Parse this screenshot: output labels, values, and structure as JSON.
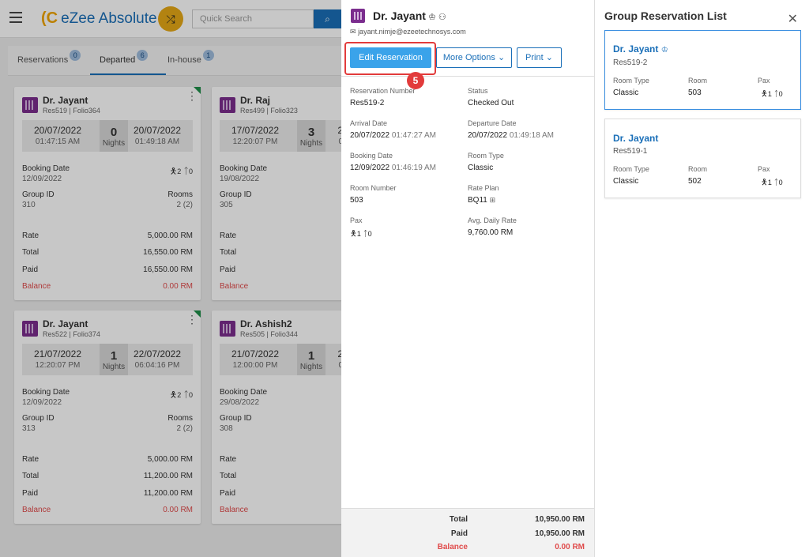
{
  "topbar": {
    "brand": "eZee Absolute",
    "search_placeholder": "Quick Search"
  },
  "tabs": [
    {
      "label": "Reservations",
      "count": "0"
    },
    {
      "label": "Departed",
      "count": "6"
    },
    {
      "label": "In-house",
      "count": "1"
    }
  ],
  "cards": [
    {
      "name": "Dr. Jayant",
      "res": "Res519 | Folio364",
      "arrival_date": "20/07/2022",
      "arrival_time": "01:47:15 AM",
      "nights": "0",
      "nights_label": "Nights",
      "departure_date": "20/07/2022",
      "departure_time": "01:49:18 AM",
      "booking_label": "Booking Date",
      "booking_date": "12/09/2022",
      "adults": "2",
      "children": "0",
      "group_label": "Group ID",
      "group_id": "310",
      "rooms_label": "Rooms",
      "rooms": "2 (2)",
      "rate_label": "Rate",
      "rate": "5,000.00 RM",
      "total_label": "Total",
      "total": "16,550.00 RM",
      "paid_label": "Paid",
      "paid": "16,550.00 RM",
      "balance_label": "Balance",
      "balance": "0.00 RM"
    },
    {
      "name": "Dr. Raj",
      "res": "Res499 | Folio323",
      "arrival_date": "17/07/2022",
      "arrival_time": "12:20:07 PM",
      "nights": "3",
      "nights_label": "Nights",
      "departure_date": "20",
      "departure_time": "04",
      "booking_label": "Booking Date",
      "booking_date": "19/08/2022",
      "group_label": "Group ID",
      "group_id": "305",
      "rate_label": "Rate",
      "total_label": "Total",
      "paid_label": "Paid",
      "balance_label": "Balance"
    },
    {
      "name": "Dr. Jayant",
      "res": "Res522 | Folio374",
      "arrival_date": "21/07/2022",
      "arrival_time": "12:20:07 PM",
      "nights": "1",
      "nights_label": "Nights",
      "departure_date": "22/07/2022",
      "departure_time": "06:04:16 PM",
      "booking_label": "Booking Date",
      "booking_date": "12/09/2022",
      "adults": "2",
      "children": "0",
      "group_label": "Group ID",
      "group_id": "313",
      "rooms_label": "Rooms",
      "rooms": "2 (2)",
      "rate_label": "Rate",
      "rate": "5,000.00 RM",
      "total_label": "Total",
      "total": "11,200.00 RM",
      "paid_label": "Paid",
      "paid": "11,200.00 RM",
      "balance_label": "Balance",
      "balance": "0.00 RM"
    },
    {
      "name": "Dr. Ashish2",
      "res": "Res505 | Folio344",
      "arrival_date": "21/07/2022",
      "arrival_time": "12:00:00 PM",
      "nights": "1",
      "nights_label": "Nights",
      "departure_date": "22",
      "departure_time": "06",
      "booking_label": "Booking Date",
      "booking_date": "29/08/2022",
      "group_label": "Group ID",
      "group_id": "308",
      "rate_label": "Rate",
      "total_label": "Total",
      "paid_label": "Paid",
      "balance_label": "Balance"
    }
  ],
  "panel": {
    "name": "Dr. Jayant",
    "email": "jayant.nimje@ezeetechnosys.com",
    "edit_label": "Edit Reservation",
    "more_label": "More Options",
    "print_label": "Print",
    "step_number": "5",
    "fields": {
      "res_no_label": "Reservation Number",
      "res_no": "Res519-2",
      "status_label": "Status",
      "status": "Checked Out",
      "arrival_label": "Arrival Date",
      "arrival_date": "20/07/2022",
      "arrival_time": "01:47:27 AM",
      "departure_label": "Departure Date",
      "departure_date": "20/07/2022",
      "departure_time": "01:49:18 AM",
      "booking_label": "Booking Date",
      "booking_date": "12/09/2022",
      "booking_time": "01:46:19 AM",
      "room_type_label": "Room Type",
      "room_type": "Classic",
      "room_no_label": "Room Number",
      "room_no": "503",
      "rate_plan_label": "Rate Plan",
      "rate_plan": "BQ11",
      "pax_label": "Pax",
      "adults": "1",
      "children": "0",
      "adr_label": "Avg. Daily Rate",
      "adr": "9,760.00 RM"
    },
    "totals": {
      "total_label": "Total",
      "total": "10,950.00 RM",
      "paid_label": "Paid",
      "paid": "10,950.00 RM",
      "balance_label": "Balance",
      "balance": "0.00 RM"
    }
  },
  "group": {
    "title": "Group Reservation List",
    "items": [
      {
        "name": "Dr. Jayant",
        "res": "Res519-2",
        "room_type_label": "Room Type",
        "room_type": "Classic",
        "room_label": "Room",
        "room": "503",
        "pax_label": "Pax",
        "adults": "1",
        "children": "0"
      },
      {
        "name": "Dr. Jayant",
        "res": "Res519-1",
        "room_type_label": "Room Type",
        "room_type": "Classic",
        "room_label": "Room",
        "room": "502",
        "pax_label": "Pax",
        "adults": "1",
        "children": "0"
      }
    ]
  },
  "colors": {
    "brand": "#1a6fb8",
    "accent": "#3aa3ea",
    "balance": "#e04a4a",
    "highlight": "#e23b3b"
  }
}
